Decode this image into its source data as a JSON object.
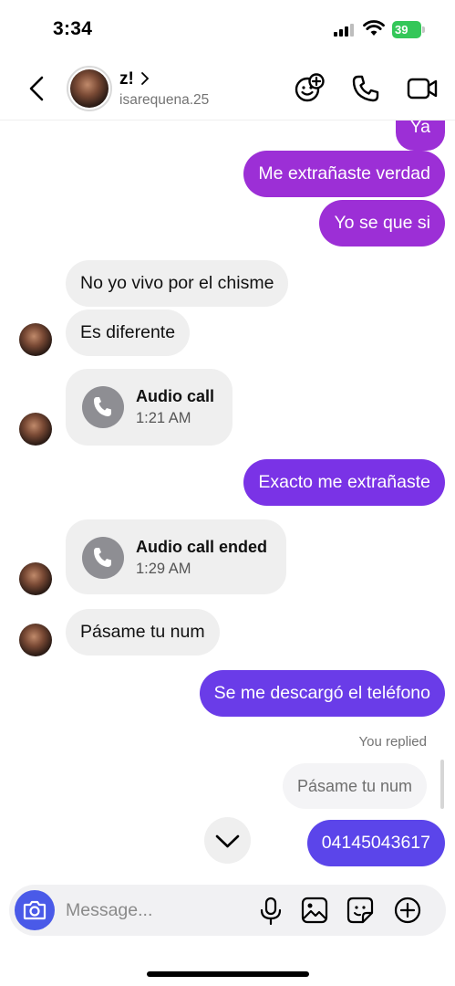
{
  "status_bar": {
    "time": "3:34",
    "battery": "39"
  },
  "header": {
    "contact_name": "z!",
    "username": "isarequena.25",
    "icons": [
      "back-chevron-icon",
      "add-emoji-icon",
      "phone-icon",
      "video-icon"
    ]
  },
  "messages": [
    {
      "type": "outgoing",
      "text": "Ya"
    },
    {
      "type": "outgoing",
      "text": "Me extrañaste verdad"
    },
    {
      "type": "outgoing",
      "text": "Yo se que si"
    },
    {
      "type": "incoming",
      "text": "No yo vivo por el chisme"
    },
    {
      "type": "incoming",
      "text": "Es diferente"
    },
    {
      "type": "call",
      "title": "Audio call",
      "time": "1:21 AM"
    },
    {
      "type": "outgoing",
      "text": "Exacto me extrañaste"
    },
    {
      "type": "call",
      "title": "Audio call ended",
      "time": "1:29 AM"
    },
    {
      "type": "incoming",
      "text": "Pásame tu num"
    },
    {
      "type": "outgoing",
      "text": "Se me descargó el teléfono"
    },
    {
      "type": "reply_label",
      "text": "You replied"
    },
    {
      "type": "reply_preview",
      "text": "Pásame tu num"
    },
    {
      "type": "outgoing",
      "text": "04145043617"
    }
  ],
  "composer": {
    "placeholder": "Message..."
  },
  "colors": {
    "purple": "#9c2fd6",
    "violet": "#7a33e6",
    "blue": "#5b45ea",
    "camera": "#4a5ae8"
  }
}
